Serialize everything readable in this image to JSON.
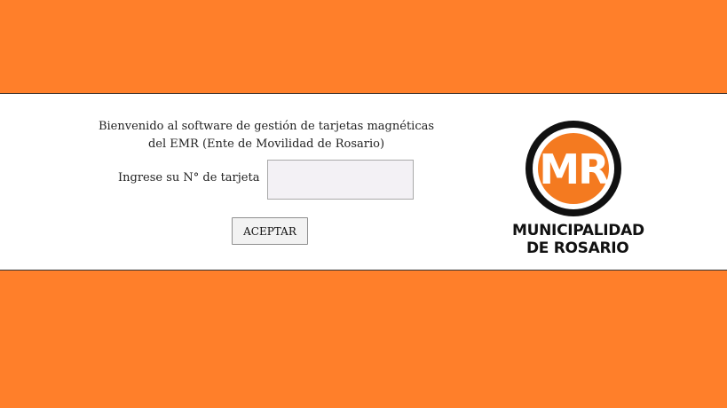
{
  "colors": {
    "background": "#ff7f2a",
    "panel": "#ffffff",
    "logo_orange": "#f47a20",
    "logo_black": "#111111"
  },
  "login": {
    "welcome_line1": "Bienvenido al software de gestión de tarjetas magnéticas",
    "welcome_line2": "del EMR (Ente de Movilidad de Rosario)",
    "card_label": "Ingrese su N° de tarjeta",
    "card_value": "",
    "accept_label": "ACEPTAR"
  },
  "logo": {
    "monogram": "MR",
    "line1": "MUNICIPALIDAD",
    "line2": "DE ROSARIO"
  }
}
